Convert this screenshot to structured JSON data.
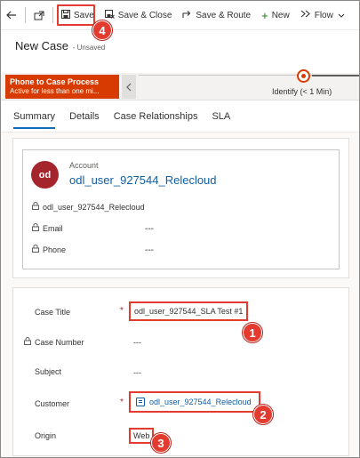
{
  "command_bar": {
    "back_icon": "back-arrow-icon",
    "popout_icon": "open-in-new-window-icon",
    "save_label": "Save",
    "save_close_label": "Save & Close",
    "save_route_label": "Save & Route",
    "new_label": "New",
    "flow_label": "Flow"
  },
  "header": {
    "title": "New Case",
    "status": "- Unsaved"
  },
  "process_bar": {
    "process_name": "Phone to Case Process",
    "duration_text": "Active for less than one mi...",
    "stage_label": "Identify  (< 1 Min)"
  },
  "tabs": [
    {
      "label": "Summary",
      "selected": true
    },
    {
      "label": "Details",
      "selected": false
    },
    {
      "label": "Case Relationships",
      "selected": false
    },
    {
      "label": "SLA",
      "selected": false
    }
  ],
  "account_card": {
    "avatar_initials": "od",
    "label": "Account",
    "name": "odl_user_927544_Relecloud",
    "owner": "odl_user_927544_Relecloud",
    "email_label": "Email",
    "email_value": "---",
    "phone_label": "Phone",
    "phone_value": "---"
  },
  "form": {
    "case_title_label": "Case Title",
    "case_title_value": "odl_user_927544_SLA Test #1",
    "case_number_label": "Case Number",
    "case_number_value": "---",
    "subject_label": "Subject",
    "subject_value": "---",
    "customer_label": "Customer",
    "customer_value": "odl_user_927544_Relecloud",
    "origin_label": "Origin",
    "origin_value": "Web",
    "required_marker": "*"
  },
  "steps": {
    "step1": "1",
    "step2": "2",
    "step3": "3",
    "step4": "4"
  },
  "colors": {
    "accent_blue": "#115ea3",
    "process_orange": "#d83b01",
    "highlight_red": "#e33b2f",
    "avatar_red": "#a4262c"
  }
}
